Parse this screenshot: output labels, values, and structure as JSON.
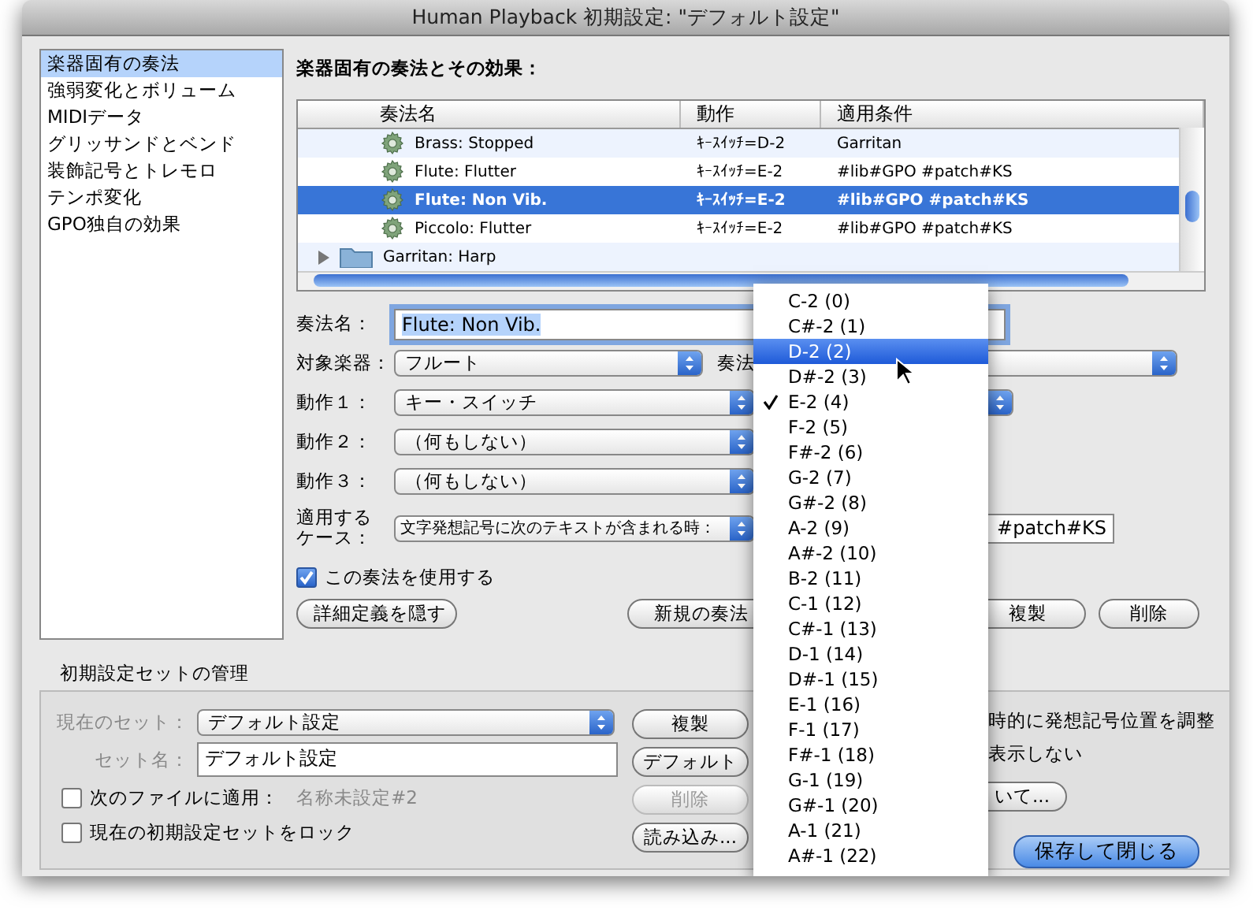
{
  "window": {
    "title": "Human Playback 初期設定: \"デフォルト設定\""
  },
  "sidebar": {
    "items": [
      {
        "label": "楽器固有の奏法",
        "selected": true
      },
      {
        "label": "強弱変化とボリューム",
        "selected": false
      },
      {
        "label": "MIDIデータ",
        "selected": false
      },
      {
        "label": "グリッサンドとベンド",
        "selected": false
      },
      {
        "label": "装飾記号とトレモロ",
        "selected": false
      },
      {
        "label": "テンポ変化",
        "selected": false
      },
      {
        "label": "GPO独自の効果",
        "selected": false
      }
    ]
  },
  "panel": {
    "heading": "楽器固有の奏法とその効果：",
    "table": {
      "columns": [
        "奏法名",
        "動作",
        "適用条件"
      ],
      "rows": [
        {
          "kind": "technique",
          "name": "Brass: Stopped",
          "action": "ｷｰｽｲｯﾁ=D-2",
          "condition": "Garritan",
          "selected": false
        },
        {
          "kind": "technique",
          "name": "Flute: Flutter",
          "action": "ｷｰｽｲｯﾁ=E-2",
          "condition": "#lib#GPO #patch#KS",
          "selected": false
        },
        {
          "kind": "technique",
          "name": "Flute: Non Vib.",
          "action": "ｷｰｽｲｯﾁ=E-2",
          "condition": "#lib#GPO #patch#KS",
          "selected": true
        },
        {
          "kind": "technique",
          "name": "Piccolo: Flutter",
          "action": "ｷｰｽｲｯﾁ=E-2",
          "condition": "#lib#GPO #patch#KS",
          "selected": false
        },
        {
          "kind": "folder",
          "name": "Garritan: Harp",
          "selected": false
        }
      ]
    },
    "name_label": "奏法名：",
    "name_value": "Flute: Non Vib.",
    "instrument_label": "対象楽器：",
    "instrument": "フルート",
    "technique_label": "奏法",
    "actions": [
      {
        "label": "動作１：",
        "value": "キー・スイッチ"
      },
      {
        "label": "動作２：",
        "value": "（何もしない）"
      },
      {
        "label": "動作３：",
        "value": "（何もしない）"
      }
    ],
    "case_label": [
      "適用する",
      "ケース："
    ],
    "case_value": "文字発想記号に次のテキストが含まれる時：",
    "case_text": "#patch#KS",
    "use_checkbox": {
      "label": "この奏法を使用する",
      "checked": true
    },
    "buttons": [
      "詳細定義を隠す",
      "新規の奏法",
      "複製",
      "削除"
    ]
  },
  "presets": {
    "title": "初期設定セットの管理",
    "current_label": "現在のセット：",
    "current": "デフォルト設定",
    "name_label": "セット名：",
    "name": "デフォルト設定",
    "apply": {
      "label": "次のファイルに適用：",
      "checked": false
    },
    "apply_file": "名称未設定#2",
    "lock": {
      "label": "現在の初期設定セットをロック",
      "checked": false
    },
    "buttons": [
      {
        "label": "複製",
        "disabled": false
      },
      {
        "label": "デフォルト",
        "disabled": false
      },
      {
        "label": "削除",
        "disabled": true
      },
      {
        "label": "読み込み...",
        "disabled": false
      }
    ]
  },
  "options": [
    "時的に発想記号位置を調整",
    "表示しない"
  ],
  "about_button": "いて...",
  "save_button": "保存して閉じる",
  "menu": {
    "items": [
      {
        "label": "C-2 (0)",
        "selected": false,
        "checked": false
      },
      {
        "label": "C#-2 (1)",
        "selected": false,
        "checked": false
      },
      {
        "label": "D-2 (2)",
        "selected": true,
        "checked": false
      },
      {
        "label": "D#-2 (3)",
        "selected": false,
        "checked": false
      },
      {
        "label": "E-2 (4)",
        "selected": false,
        "checked": true
      },
      {
        "label": "F-2 (5)",
        "selected": false,
        "checked": false
      },
      {
        "label": "F#-2 (6)",
        "selected": false,
        "checked": false
      },
      {
        "label": "G-2 (7)",
        "selected": false,
        "checked": false
      },
      {
        "label": "G#-2 (8)",
        "selected": false,
        "checked": false
      },
      {
        "label": "A-2 (9)",
        "selected": false,
        "checked": false
      },
      {
        "label": "A#-2 (10)",
        "selected": false,
        "checked": false
      },
      {
        "label": "B-2 (11)",
        "selected": false,
        "checked": false
      },
      {
        "label": "C-1 (12)",
        "selected": false,
        "checked": false
      },
      {
        "label": "C#-1 (13)",
        "selected": false,
        "checked": false
      },
      {
        "label": "D-1 (14)",
        "selected": false,
        "checked": false
      },
      {
        "label": "D#-1 (15)",
        "selected": false,
        "checked": false
      },
      {
        "label": "E-1 (16)",
        "selected": false,
        "checked": false
      },
      {
        "label": "F-1 (17)",
        "selected": false,
        "checked": false
      },
      {
        "label": "F#-1 (18)",
        "selected": false,
        "checked": false
      },
      {
        "label": "G-1 (19)",
        "selected": false,
        "checked": false
      },
      {
        "label": "G#-1 (20)",
        "selected": false,
        "checked": false
      },
      {
        "label": "A-1 (21)",
        "selected": false,
        "checked": false
      },
      {
        "label": "A#-1 (22)",
        "selected": false,
        "checked": false
      }
    ]
  }
}
